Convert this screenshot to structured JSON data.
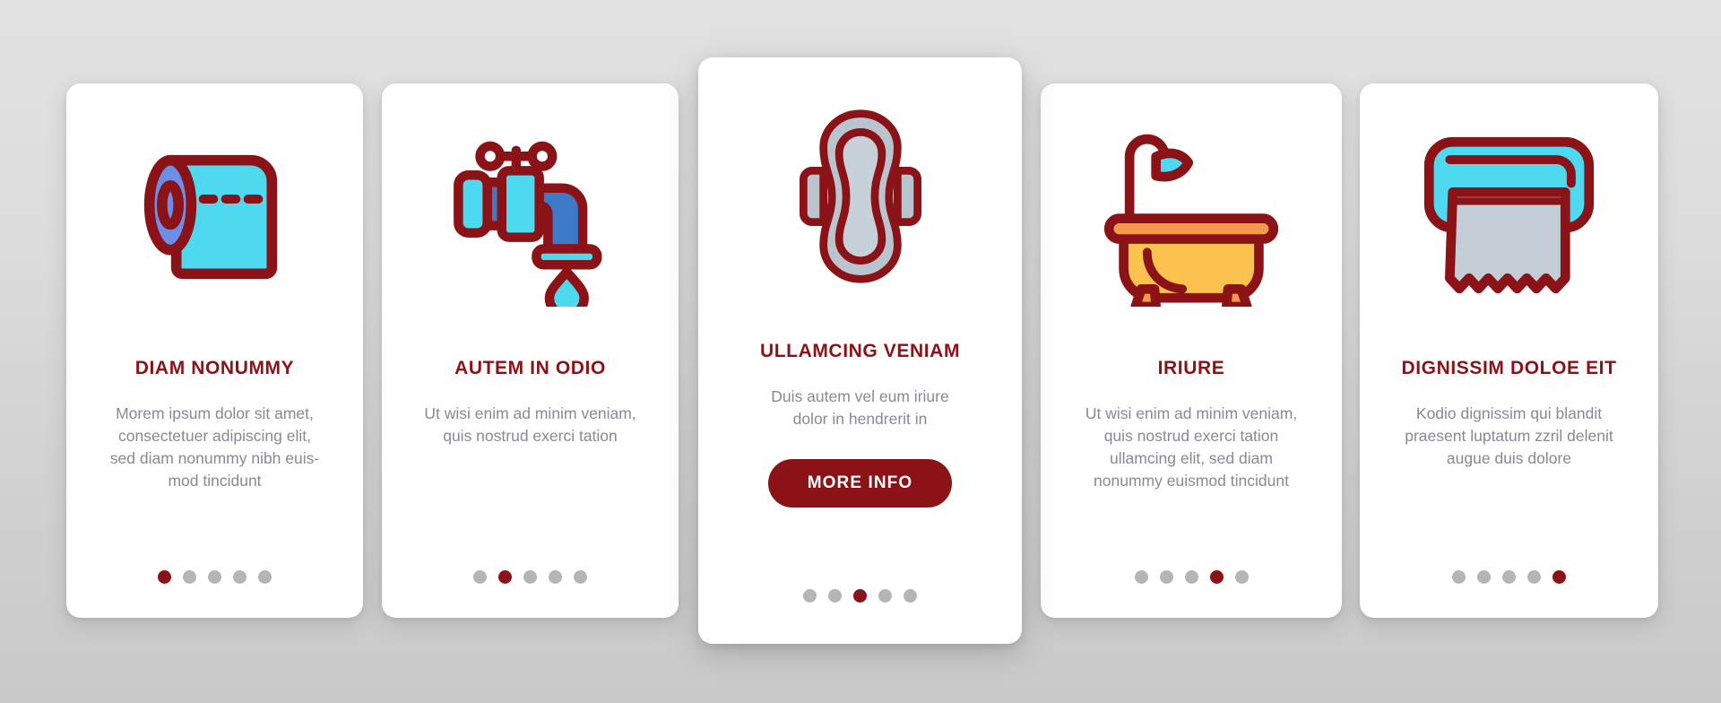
{
  "palette": {
    "dark_red": "#8B1216",
    "cyan": "#4DD9F0",
    "blue": "#3D7BC8",
    "periwinkle": "#6B8FE8",
    "gray_blue": "#B8C4CE",
    "orange": "#F59A4D",
    "yellow": "#FBC34E",
    "body_text": "#8D8795",
    "dot_inactive": "#B5B5B5",
    "card_bg": "#FFFFFF"
  },
  "cards": [
    {
      "icon": "toilet-paper-roll-icon",
      "title": "DIAM NONUMMY",
      "body": "Morem ipsum dolor sit amet, consectetuer adipiscing elit, sed diam nonummy nibh euis-mod tincidunt",
      "active_dot": 1,
      "dot_count": 5,
      "has_button": false
    },
    {
      "icon": "water-faucet-icon",
      "title": "AUTEM IN ODIO",
      "body": "Ut wisi enim ad minim veniam, quis nostrud exerci tation",
      "active_dot": 2,
      "dot_count": 5,
      "has_button": false
    },
    {
      "icon": "sanitary-pad-icon",
      "title": "ULLAMCING VENIAM",
      "body": "Duis autem vel eum iriure dolor in hendrerit in",
      "button_label": "MORE INFO",
      "active_dot": 3,
      "dot_count": 5,
      "has_button": true
    },
    {
      "icon": "bathtub-shower-icon",
      "title": "IRIURE",
      "body": "Ut wisi enim ad minim veniam, quis nostrud exerci tation ullamcing elit, sed diam nonummy euismod tincidunt",
      "active_dot": 4,
      "dot_count": 5,
      "has_button": false
    },
    {
      "icon": "paper-towel-dispenser-icon",
      "title": "DIGNISSIM DOLOE EIT",
      "body": "Kodio dignissim qui blandit praesent luptatum zzril delenit augue duis dolore",
      "active_dot": 5,
      "dot_count": 5,
      "has_button": false
    }
  ]
}
